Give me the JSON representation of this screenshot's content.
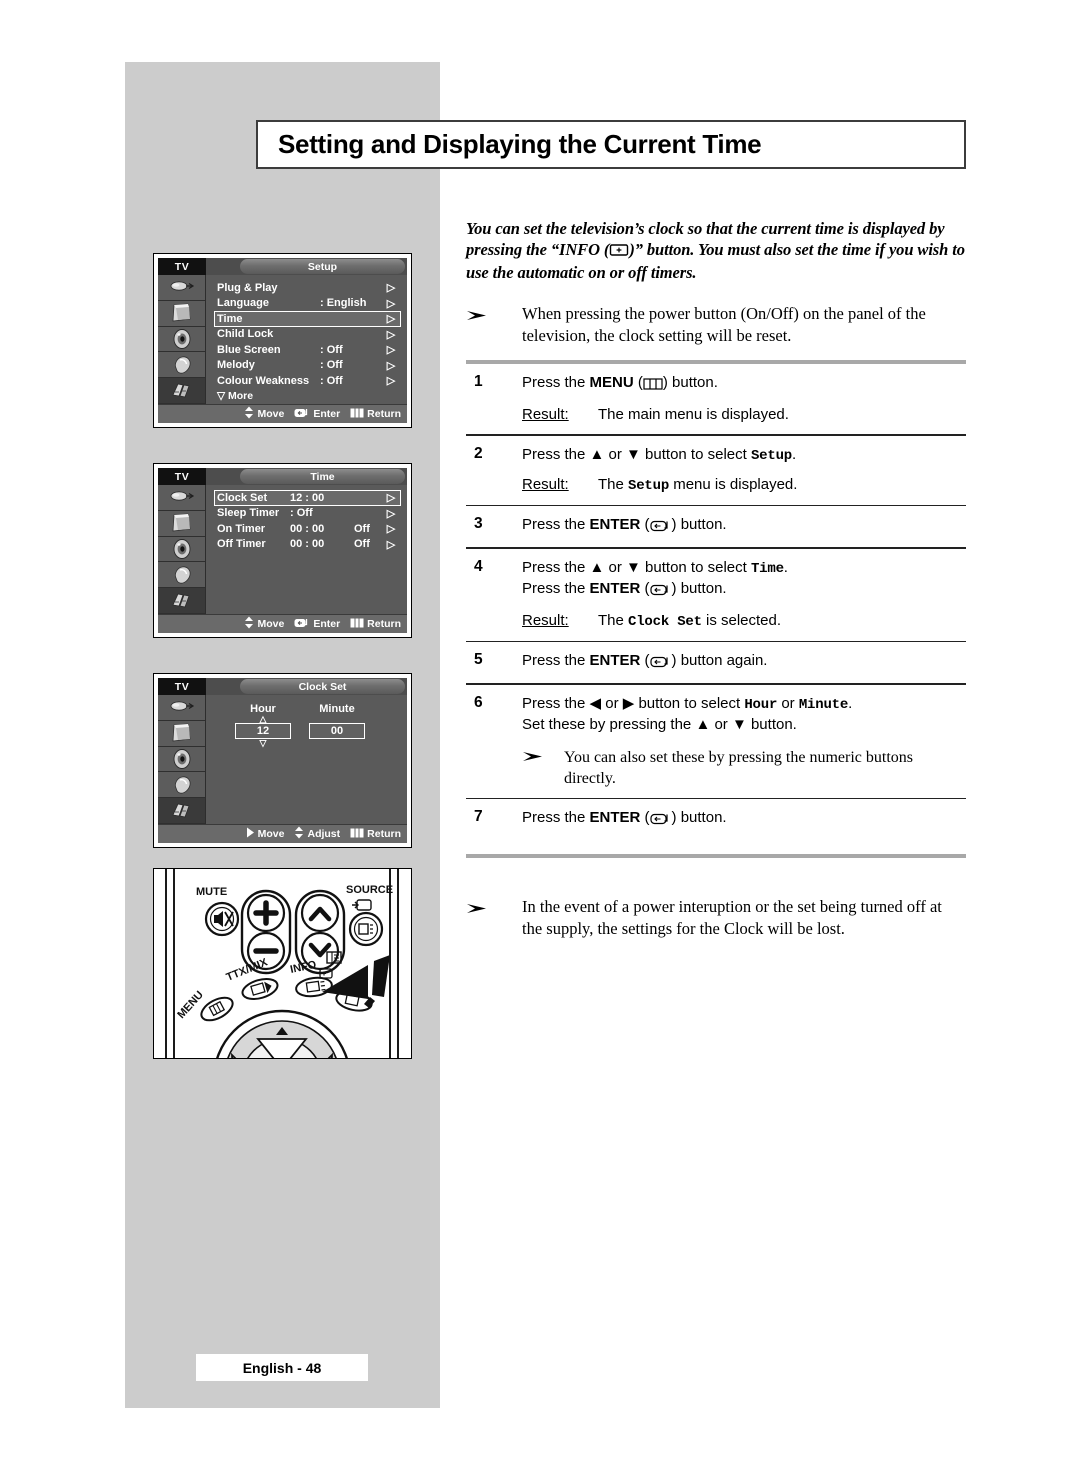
{
  "page": {
    "title": "Setting and Displaying the Current Time",
    "footer_label": "English - 48",
    "intro_part1": "You can set the television’s clock so that the current time is displayed by pressing the “INFO (",
    "intro_part2": ")” button. You must also set the time if you wish to use the automatic on or off timers."
  },
  "notes": {
    "top": "When pressing the power button (On/Off) on the panel of the television, the clock setting will be reset.",
    "numeric": "You can also set these by pressing the numeric buttons directly.",
    "bottom": "In the event of a power interuption or the set being turned off at the supply, the settings for the Clock will be lost."
  },
  "steps": [
    {
      "num": "1",
      "line1_pre": "Press the ",
      "line1_bold": "MENU",
      "line1_mid": " (",
      "line1_post": ") button.",
      "result_label": "Result:",
      "result_pre": "The main menu is displayed.",
      "result_mono": "",
      "result_post": ""
    },
    {
      "num": "2",
      "line1_pre": "Press the ▲ or ▼ button to select ",
      "line1_mono": "Setup",
      "line1_post": ".",
      "result_label": "Result:",
      "result_pre": "The ",
      "result_mono": "Setup",
      "result_post": " menu is displayed."
    },
    {
      "num": "3",
      "line1_pre": "Press the ",
      "line1_bold": "ENTER",
      "line1_mid": " (",
      "line1_post": ") button."
    },
    {
      "num": "4",
      "line1_pre": "Press the ▲ or ▼ button to select ",
      "line1_mono": "Time",
      "line1_post": ".",
      "line2_pre": "Press the ",
      "line2_bold": "ENTER",
      "line2_mid": " (",
      "line2_post": ") button.",
      "result_label": "Result:",
      "result_pre": "The ",
      "result_mono": "Clock Set",
      "result_post": " is selected."
    },
    {
      "num": "5",
      "line1_pre": "Press the ",
      "line1_bold": "ENTER",
      "line1_mid": " (",
      "line1_post": ") button again."
    },
    {
      "num": "6",
      "line1_pre": "Press the ◀ or ▶ button to select ",
      "line1_mono": "Hour",
      "line1_mid2": " or ",
      "line1_mono2": "Minute",
      "line1_post": ".",
      "line2": "Set these by pressing the ▲ or ▼ button."
    },
    {
      "num": "7",
      "line1_pre": "Press the ",
      "line1_bold": "ENTER",
      "line1_mid": " (",
      "line1_post": ") button."
    }
  ],
  "osd_setup": {
    "tv_tag": "TV",
    "tab_title": "Setup",
    "rows": [
      {
        "label": "Plug & Play",
        "value": "",
        "value2": "",
        "arrow": "▷",
        "selected": false
      },
      {
        "label": "Language",
        "value": ": English",
        "value2": "",
        "arrow": "▷",
        "selected": false
      },
      {
        "label": "Time",
        "value": "",
        "value2": "",
        "arrow": "▷",
        "selected": true
      },
      {
        "label": "Child Lock",
        "value": "",
        "value2": "",
        "arrow": "▷",
        "selected": false
      },
      {
        "label": "Blue Screen",
        "value": ": Off",
        "value2": "",
        "arrow": "▷",
        "selected": false
      },
      {
        "label": "Melody",
        "value": ": Off",
        "value2": "",
        "arrow": "▷",
        "selected": false
      },
      {
        "label": "Colour Weakness",
        "value": ": Off",
        "value2": "",
        "arrow": "▷",
        "selected": false
      }
    ],
    "more_label": "▽ More",
    "bottom": {
      "move": "Move",
      "enter": "Enter",
      "return": "Return"
    }
  },
  "osd_time": {
    "tv_tag": "TV",
    "tab_title": "Time",
    "rows": [
      {
        "label": "Clock Set",
        "value": "12 : 00",
        "value2": "",
        "arrow": "▷",
        "selected": true
      },
      {
        "label": "Sleep Timer",
        "value": ": Off",
        "value2": "",
        "arrow": "▷",
        "selected": false
      },
      {
        "label": "On Timer",
        "value": "00 : 00",
        "value2": "Off",
        "arrow": "▷",
        "selected": false
      },
      {
        "label": "Off Timer",
        "value": "00 : 00",
        "value2": "Off",
        "arrow": "▷",
        "selected": false
      }
    ],
    "bottom": {
      "move": "Move",
      "enter": "Enter",
      "return": "Return"
    }
  },
  "osd_clockset": {
    "tv_tag": "TV",
    "tab_title": "Clock Set",
    "hour_label": "Hour",
    "hour_value": "12",
    "minute_label": "Minute",
    "minute_value": "00",
    "bottom": {
      "move": "Move",
      "adjust": "Adjust",
      "return": "Return"
    }
  },
  "remote": {
    "mute_label": "MUTE",
    "source_label": "SOURCE",
    "ttx_label": "TTX/MIX",
    "info_label": "INFO",
    "menu_label": "MENU"
  },
  "colors": {
    "grey_panel": "#cccccc",
    "osd_body": "#5a5a5a",
    "separator": "#a8a8a8",
    "text": "#000000"
  }
}
